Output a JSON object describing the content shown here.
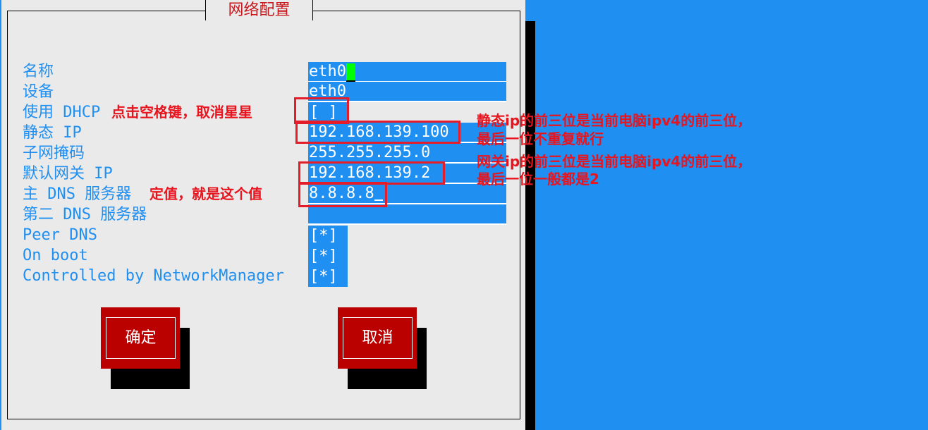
{
  "dialog": {
    "title": "网络配置",
    "labels": {
      "name": "名称",
      "device": "设备",
      "dhcp": "使用 DHCP",
      "static_ip": "静态 IP",
      "netmask": "子网掩码",
      "gateway": "默认网关 IP",
      "dns1": "主 DNS 服务器",
      "dns2": "第二 DNS 服务器",
      "peer_dns": "Peer DNS",
      "on_boot": "On boot",
      "nm_controlled": "Controlled by NetworkManager"
    },
    "values": {
      "name": "eth0",
      "device": "eth0",
      "dhcp": "[ ]",
      "static_ip": "192.168.139.100",
      "netmask": "255.255.255.0",
      "gateway": "192.168.139.2",
      "dns1": "8.8.8.8",
      "dns2": "",
      "peer_dns": "[*]",
      "on_boot": "[*]",
      "nm_controlled": "[*]"
    },
    "buttons": {
      "ok": "确定",
      "cancel": "取消"
    }
  },
  "annotations": {
    "dhcp_note": "点击空格键，取消星星",
    "dns_note": "定值，就是这个值",
    "static_ip_note_1": "静态ip的前三位是当前电脑ipv4的前三位，",
    "static_ip_note_2": "最后一位不重复就行",
    "gateway_note_1": "网关ip的前三位是当前电脑ipv4的前三位，",
    "gateway_note_2": "最后一位一般都是2"
  },
  "colors": {
    "background": "#1f8ff1",
    "panel": "#eaeaea",
    "label": "#1f8ff1",
    "field": "#1f8ff1",
    "button": "#bb0000",
    "annotation": "#e8141e",
    "cursor": "#00ff00"
  }
}
